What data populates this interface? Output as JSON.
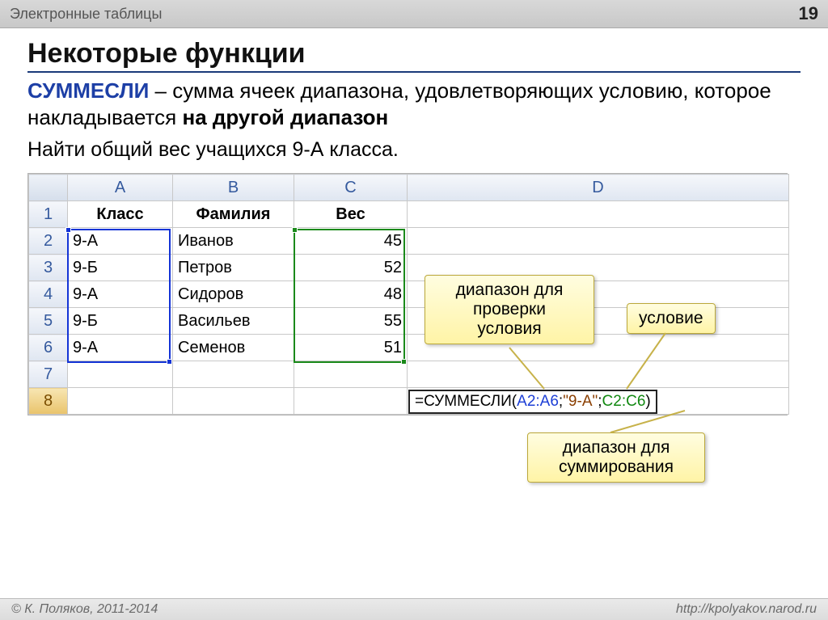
{
  "header": {
    "subject": "Электронные таблицы",
    "page_number": "19"
  },
  "title": "Некоторые функции",
  "intro": {
    "fn_name": "СУММЕСЛИ",
    "text1": " – сумма ячеек диапазона, удовлетворяющих условию, которое накладывается ",
    "bold_tail": "на другой диапазон"
  },
  "task": "Найти общий вес учащихся 9-А класса.",
  "columns": [
    "A",
    "B",
    "C",
    "D"
  ],
  "row_labels": [
    "1",
    "2",
    "3",
    "4",
    "5",
    "6",
    "7",
    "8"
  ],
  "table_header": {
    "class": "Класс",
    "surname": "Фамилия",
    "weight": "Вес"
  },
  "rows": [
    {
      "class": "9-А",
      "surname": "Иванов",
      "weight": "45"
    },
    {
      "class": "9-Б",
      "surname": "Петров",
      "weight": "52"
    },
    {
      "class": "9-А",
      "surname": "Сидоров",
      "weight": "48"
    },
    {
      "class": "9-Б",
      "surname": "Васильев",
      "weight": "55"
    },
    {
      "class": "9-А",
      "surname": "Семенов",
      "weight": "51"
    }
  ],
  "formula": {
    "prefix": "=СУММЕСЛИ(",
    "arg1": "A2:A6",
    "sep1": ";",
    "arg2": "\"9-А\"",
    "sep2": ";",
    "arg3": "C2:C6",
    "suffix": ")"
  },
  "callouts": {
    "range_check": "диапазон для\nпроверки\nусловия",
    "condition": "условие",
    "range_sum": "диапазон для\nсуммирования"
  },
  "footer": {
    "copyright": "© К. Поляков, 2011-2014",
    "url": "http://kpolyakov.narod.ru"
  },
  "colors": {
    "blue_range": "#1434d6",
    "green_range": "#1b8a1b",
    "callout_bg": "#fff4a6"
  }
}
